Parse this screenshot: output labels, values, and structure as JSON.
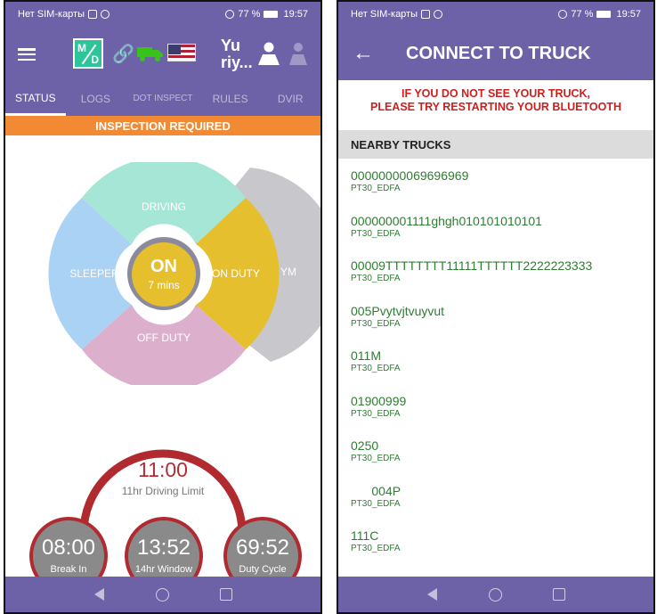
{
  "status_bar": {
    "carrier": "Нет SIM-карты",
    "battery": "77 %",
    "time": "19:57"
  },
  "left": {
    "user_name": "Yu riy...",
    "tabs": [
      {
        "label": "STATUS",
        "active": true
      },
      {
        "label": "LOGS",
        "active": false
      },
      {
        "label": "DOT INSPECT",
        "active": false
      },
      {
        "label": "RULES",
        "active": false
      },
      {
        "label": "DVIR",
        "active": false
      }
    ],
    "banner": "INSPECTION REQUIRED",
    "wheel": {
      "driving": "DRIVING",
      "sleeper": "SLEEPER",
      "on_duty": "ON DUTY",
      "off_duty": "OFF DUTY",
      "ym": "YM",
      "center_status": "ON",
      "center_duration": "7 mins"
    },
    "limit": {
      "time": "11:00",
      "label": "11hr Driving Limit"
    },
    "clocks": [
      {
        "time": "08:00",
        "label": "Break In"
      },
      {
        "time": "13:52",
        "label": "14hr Window"
      },
      {
        "time": "69:52",
        "label": "Duty Cycle"
      }
    ]
  },
  "right": {
    "title": "CONNECT TO TRUCK",
    "warning_line1": "IF YOU DO NOT SEE YOUR TRUCK,",
    "warning_line2": "PLEASE TRY RESTARTING YOUR BLUETOOTH",
    "section": "NEARBY TRUCKS",
    "trucks": [
      {
        "name": "00000000069696969",
        "sub": "PT30_EDFA"
      },
      {
        "name": "000000001111ghgh010101010101",
        "sub": "PT30_EDFA"
      },
      {
        "name": "00009TTTTTTTT11111TTTTTT2222223333",
        "sub": "PT30_EDFA"
      },
      {
        "name": "005Pvytvjtvuyvut",
        "sub": "PT30_EDFA"
      },
      {
        "name": "011M",
        "sub": "PT30_EDFA"
      },
      {
        "name": "01900999",
        "sub": "PT30_EDFA"
      },
      {
        "name": "0250",
        "sub": "PT30_EDFA"
      },
      {
        "name": "      004P",
        "sub": "PT30_EDFA"
      },
      {
        "name": "111C",
        "sub": "PT30_EDFA"
      }
    ]
  },
  "colors": {
    "header": "#6d62a8",
    "orange": "#f28a34",
    "driving": "#a6e6d6",
    "sleeper": "#a9d2f5",
    "on_duty": "#e6bf2f",
    "off_duty": "#dcb0cd",
    "ym": "#c8c8cc",
    "limit_red": "#b02a30",
    "truck_green": "#2e7d32"
  }
}
